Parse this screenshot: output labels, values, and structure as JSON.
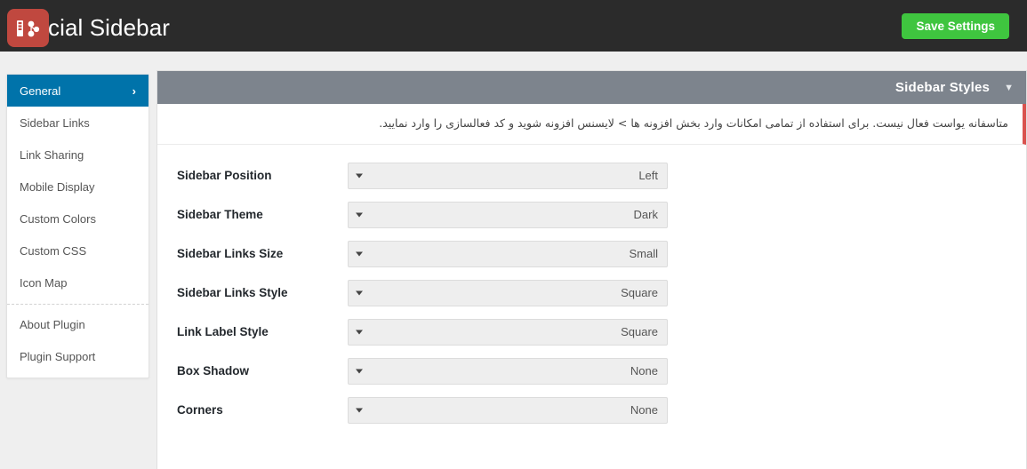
{
  "topbar": {
    "logo_icon": "social-sidebar-logo-icon",
    "title": "Social Sidebar",
    "save_label": "Save Settings",
    "save_color": "#3fc53f",
    "bg_color": "#2b2b2b"
  },
  "sidebar": {
    "items": [
      {
        "label": "General",
        "active": true,
        "chevron": "›"
      },
      {
        "label": "Sidebar Links",
        "active": false
      },
      {
        "label": "Link Sharing",
        "active": false
      },
      {
        "label": "Mobile Display",
        "active": false
      },
      {
        "label": "Custom Colors",
        "active": false
      },
      {
        "label": "Custom CSS",
        "active": false
      },
      {
        "label": "Icon Map",
        "active": false
      }
    ],
    "secondary_items": [
      {
        "label": "About Plugin"
      },
      {
        "label": "Plugin Support"
      }
    ],
    "active_color": "#0073aa"
  },
  "panel": {
    "title": "Sidebar Styles",
    "toggle_icon": "chevron-down-icon",
    "header_color": "#7d848d",
    "notice": {
      "text": "متاسفانه یواست فعال نیست. برای استفاده از تمامی امکانات وارد بخش افزونه ها > لایسنس افزونه شوید و کد فعالسازی را وارد نمایید.",
      "accent_color": "#d9534f"
    },
    "rows": [
      {
        "label": "Sidebar Position",
        "value": "Left",
        "two_line": false
      },
      {
        "label": "Sidebar Theme",
        "value": "Dark",
        "two_line": false
      },
      {
        "label": "Sidebar Links Size",
        "value": "Small",
        "two_line": true
      },
      {
        "label": "Sidebar Links Style",
        "value": "Square",
        "two_line": true
      },
      {
        "label": "Link Label Style",
        "value": "Square",
        "two_line": false
      },
      {
        "label": "Box Shadow",
        "value": "None",
        "two_line": false
      },
      {
        "label": "Corners",
        "value": "None",
        "two_line": false
      }
    ]
  }
}
